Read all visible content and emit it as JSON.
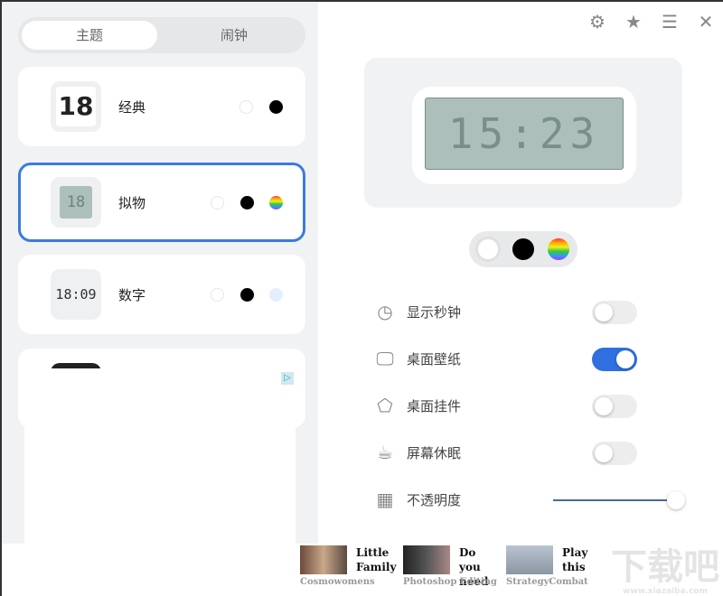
{
  "tabs": {
    "theme": "主题",
    "alarm": "闹钟"
  },
  "themes": [
    {
      "name": "经典",
      "thumb": "18",
      "colors": [
        "#ffffff",
        "#000000"
      ]
    },
    {
      "name": "拟物",
      "thumb": "18",
      "colors": [
        "#ffffff",
        "#000000",
        "rainbow"
      ],
      "selected": true
    },
    {
      "name": "数字",
      "thumb": "18:09",
      "colors": [
        "#ffffff",
        "#000000",
        "#e3effc"
      ]
    }
  ],
  "header_icons": [
    "gear-icon",
    "star-icon",
    "menu-icon",
    "close-icon"
  ],
  "preview": {
    "time": "15:23",
    "colors": [
      "#ffffff",
      "#000000",
      "rainbow"
    ],
    "selected_color": "#ffffff"
  },
  "settings": [
    {
      "label": "显示秒钟",
      "icon": "clock-icon",
      "on": false
    },
    {
      "label": "桌面壁纸",
      "icon": "monitor-icon",
      "on": true
    },
    {
      "label": "桌面挂件",
      "icon": "tag-icon",
      "on": false
    },
    {
      "label": "屏幕休眠",
      "icon": "coffee-cup-icon",
      "on": false
    }
  ],
  "opacity": {
    "label": "不透明度",
    "value_percent": 100
  },
  "accent": "#2f6fe0",
  "ads": [
    {
      "title": "Little Family",
      "source": "Cosmowomens"
    },
    {
      "title": "Do you need",
      "source": "Photoshop Editing"
    },
    {
      "title": "Play this",
      "source": "StrategyCombat"
    }
  ],
  "watermark": {
    "logo": "下载吧",
    "url": "www.xiazaiba.com"
  }
}
